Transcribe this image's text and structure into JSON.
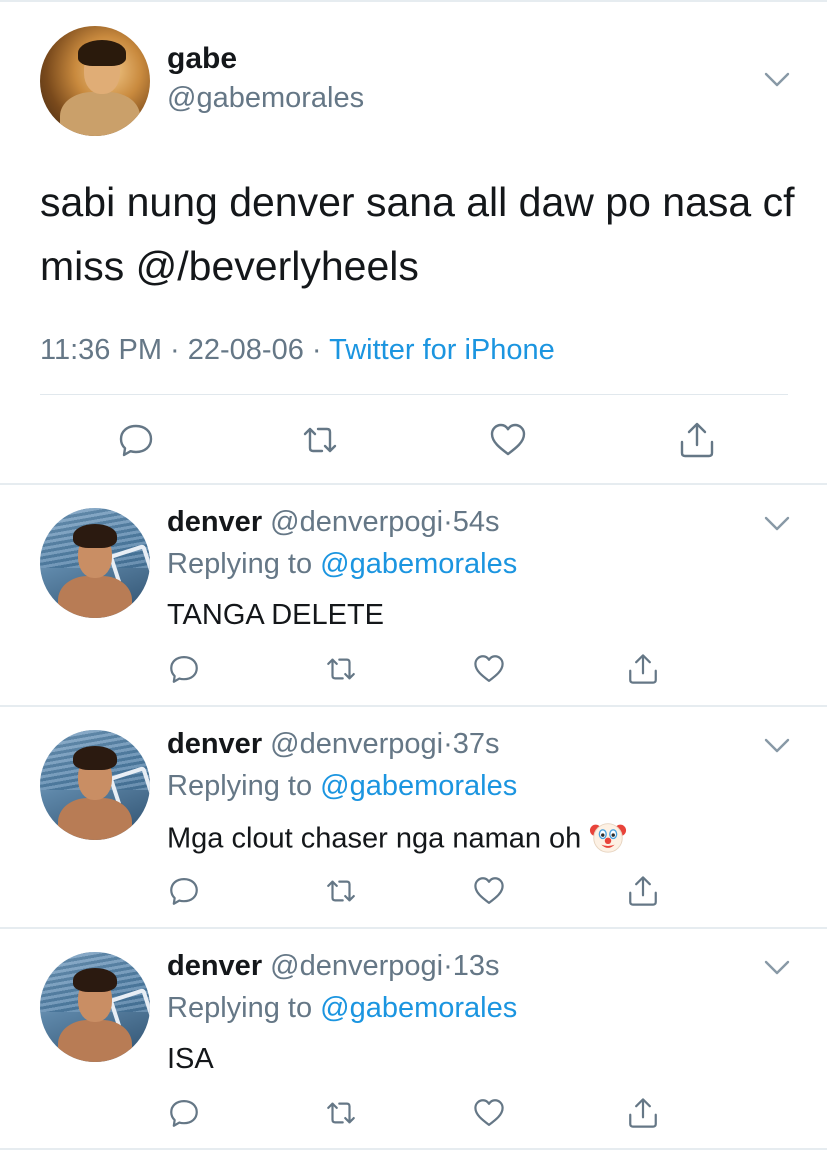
{
  "main_tweet": {
    "name": "gabe",
    "handle": "@gabemorales",
    "text": "sabi nung denver sana all daw po nasa cf miss @/beverlyheels",
    "time": "11:36 PM",
    "sep1": " · ",
    "date": "22-08-06",
    "sep2": " · ",
    "source": "Twitter for iPhone"
  },
  "replies": [
    {
      "name": "denver",
      "handle": "@denverpogi",
      "dot": "·",
      "age": "54s",
      "replying_prefix": "Replying to ",
      "replying_to": "@gabemorales",
      "text": "TANGA DELETE"
    },
    {
      "name": "denver",
      "handle": "@denverpogi",
      "dot": "·",
      "age": "37s",
      "replying_prefix": "Replying to ",
      "replying_to": "@gabemorales",
      "text": "Mga clout chaser nga naman oh",
      "emoji": "clown-face"
    },
    {
      "name": "denver",
      "handle": "@denverpogi",
      "dot": "·",
      "age": "13s",
      "replying_prefix": "Replying to ",
      "replying_to": "@gabemorales",
      "text": "ISA"
    }
  ],
  "icons": {
    "reply": "reply-icon",
    "retweet": "retweet-icon",
    "like": "heart-icon",
    "share": "share-icon",
    "menu": "chevron-down-icon"
  },
  "colors": {
    "text": "#14171a",
    "secondary": "#657786",
    "link": "#1b95e0",
    "divider": "#e6ecf0"
  }
}
